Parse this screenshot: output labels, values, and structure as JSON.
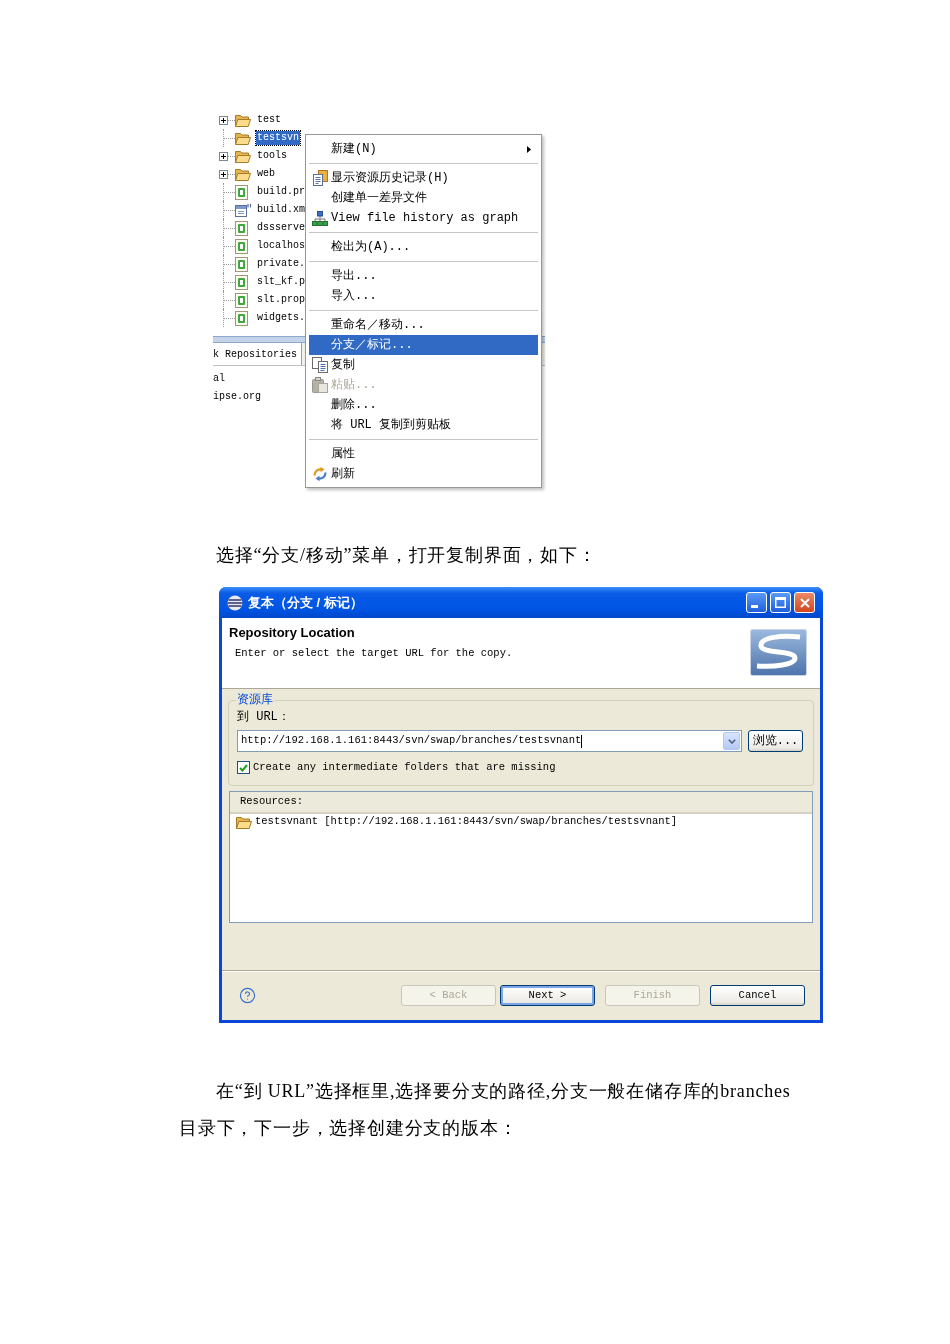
{
  "explorer": {
    "tree": [
      {
        "label": "test",
        "kind": "folder",
        "expandable": true,
        "selected": false
      },
      {
        "label": "testsvn",
        "kind": "folder",
        "expandable": false,
        "selected": true
      },
      {
        "label": "tools",
        "kind": "folder",
        "expandable": true,
        "selected": false
      },
      {
        "label": "web",
        "kind": "folder",
        "expandable": true,
        "selected": false
      },
      {
        "label": "build.pr",
        "kind": "properties",
        "expandable": false,
        "selected": false
      },
      {
        "label": "build.xm",
        "kind": "xml",
        "expandable": false,
        "selected": false
      },
      {
        "label": "dssserve",
        "kind": "properties",
        "expandable": false,
        "selected": false
      },
      {
        "label": "localhos",
        "kind": "properties",
        "expandable": false,
        "selected": false
      },
      {
        "label": "private.",
        "kind": "properties",
        "expandable": false,
        "selected": false
      },
      {
        "label": "slt_kf.p",
        "kind": "properties",
        "expandable": false,
        "selected": false
      },
      {
        "label": "slt.prop",
        "kind": "properties",
        "expandable": false,
        "selected": false
      },
      {
        "label": "widgets.",
        "kind": "properties",
        "expandable": false,
        "selected": false
      }
    ],
    "lower_panel": {
      "tab": "k Repositories",
      "rows": [
        "al",
        "ipse.org"
      ]
    },
    "context_menu": {
      "groups": [
        {
          "items": [
            {
              "label": "新建(N)",
              "submenu": true,
              "disabled": false,
              "selected": false
            }
          ]
        },
        {
          "items": [
            {
              "label": "显示资源历史记录(H)",
              "submenu": false,
              "disabled": false,
              "selected": false
            },
            {
              "label": "创建单一差异文件",
              "submenu": false,
              "disabled": false,
              "selected": false
            },
            {
              "label": "View file history as graph",
              "submenu": false,
              "disabled": false,
              "selected": false
            }
          ]
        },
        {
          "items": [
            {
              "label": "检出为(A)...",
              "submenu": false,
              "disabled": false,
              "selected": false
            }
          ]
        },
        {
          "items": [
            {
              "label": "导出...",
              "submenu": false,
              "disabled": false,
              "selected": false
            },
            {
              "label": "导入...",
              "submenu": false,
              "disabled": false,
              "selected": false
            }
          ]
        },
        {
          "items": [
            {
              "label": "重命名／移动...",
              "submenu": false,
              "disabled": false,
              "selected": false
            },
            {
              "label": "分支／标记...",
              "submenu": false,
              "disabled": false,
              "selected": true
            },
            {
              "label": "复制",
              "submenu": false,
              "disabled": false,
              "selected": false
            },
            {
              "label": "粘贴...",
              "submenu": false,
              "disabled": true,
              "selected": false
            },
            {
              "label": "删除...",
              "submenu": false,
              "disabled": false,
              "selected": false
            },
            {
              "label": "将 URL 复制到剪贴板",
              "submenu": false,
              "disabled": false,
              "selected": false
            }
          ]
        },
        {
          "items": [
            {
              "label": "属性",
              "submenu": false,
              "disabled": false,
              "selected": false
            },
            {
              "label": "刷新",
              "submenu": false,
              "disabled": false,
              "selected": false
            }
          ]
        }
      ]
    }
  },
  "paragraph_1": "选择“分支/移动”菜单，打开复制界面，如下：",
  "dialog": {
    "title": "复本（分支 / 标记）",
    "header": {
      "title": "Repository Location",
      "description": "Enter or select the target URL for the copy."
    },
    "group": {
      "legend": "资源库",
      "url_label": "到 URL：",
      "url_value": "http://192.168.1.161:8443/svn/swap/branches/testsvnant",
      "browse_button": "浏览...",
      "checkbox": {
        "label": "Create any intermediate folders that are missing",
        "checked": true
      }
    },
    "resources": {
      "header": "Resources:",
      "rows": [
        "testsvnant [http://192.168.1.161:8443/svn/swap/branches/testsvnant]"
      ]
    },
    "buttons": [
      {
        "label": "< Back",
        "disabled": true,
        "default": false
      },
      {
        "label": "Next >",
        "disabled": false,
        "default": true
      },
      {
        "label": "Finish",
        "disabled": true,
        "default": false
      },
      {
        "label": "Cancel",
        "disabled": false,
        "default": false
      }
    ]
  },
  "paragraph_2": "在“到 URL”选择框里,选择要分支的路径,分支一般在储存库的branches目录下，下一步，选择创建分支的版本："
}
